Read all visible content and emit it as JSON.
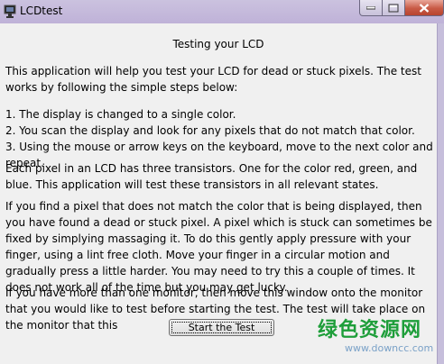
{
  "window": {
    "title": "LCDtest"
  },
  "heading": "Testing your LCD",
  "paragraphs": {
    "intro": "This application will help you test your LCD for dead or stuck pixels.  The test works by following the simple steps below:",
    "steps": "1. The display is changed to a single color.\n2. You scan the display and look for any pixels that do not match that color.\n3. Using the mouse or arrow keys on the keyboard, move to the next color and repeat.",
    "transistors": "Each pixel in an LCD has three transistors.  One for the color red, green, and blue.  This application will test these transistors in all relevant states.",
    "stuck": "If you find a pixel that does not match the color that is being displayed, then you have found a dead or stuck pixel.  A pixel which is stuck can sometimes be fixed by simplying massaging it.  To do this gently apply pressure with your finger, using a lint free cloth. Move your finger in a circular motion and gradually press a little harder.  You may need to try this a couple of times.  It does not work all of the time but you may get lucky.",
    "monitor": "If you have more than one monitor, then move this window onto the monitor that you would like to test before starting the test.  The test will take place on the monitor that this"
  },
  "start_button": {
    "label": "Start the Test"
  },
  "watermark": {
    "text": "绿色资源网",
    "url": "www.downcc.com"
  }
}
